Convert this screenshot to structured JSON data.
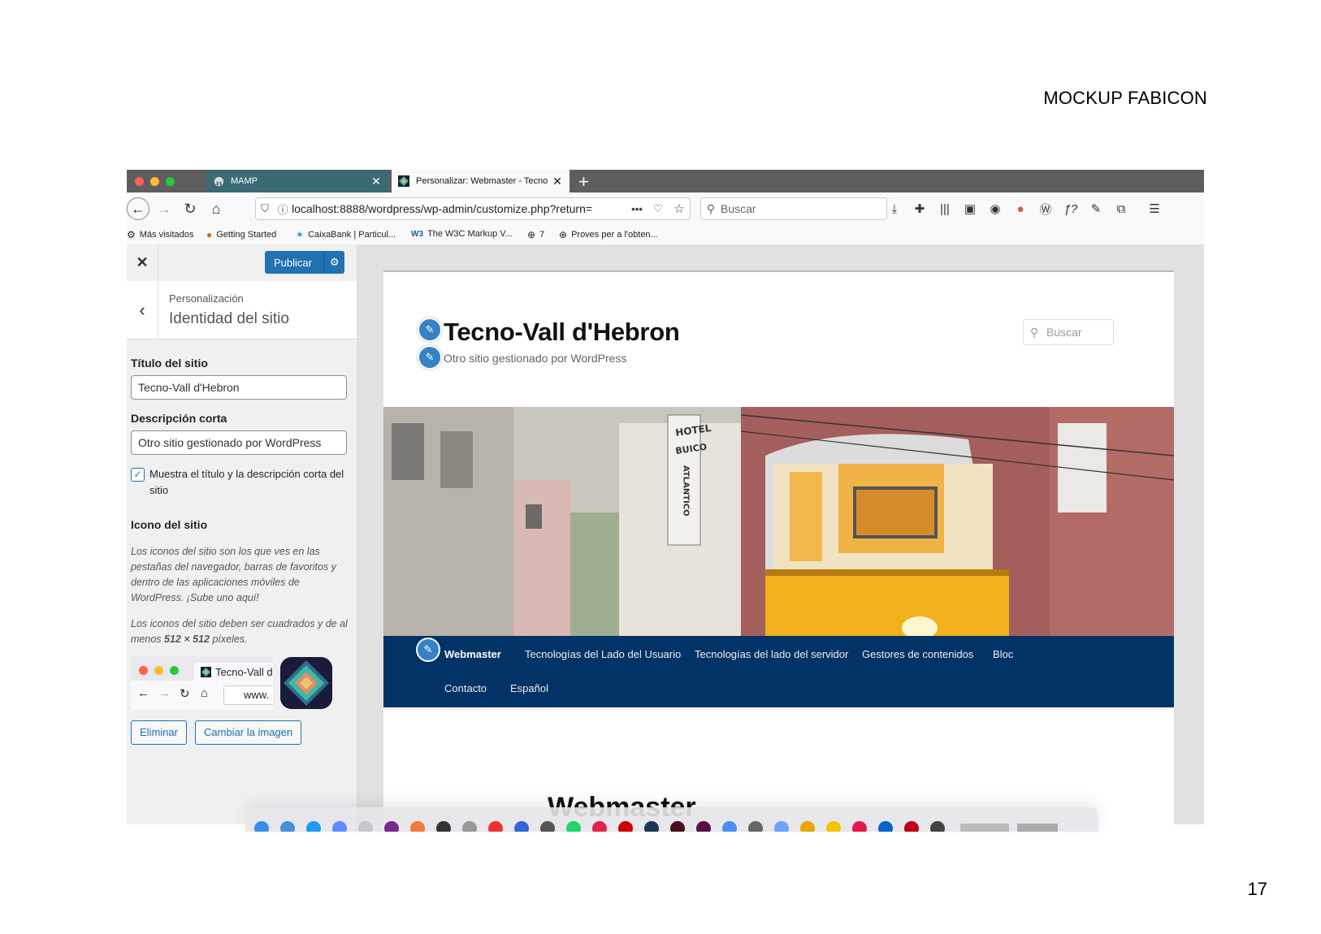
{
  "slide": {
    "title": "MOCKUP FABICON",
    "page_number": "17"
  },
  "browser": {
    "tabs": [
      {
        "label": "MAMP",
        "icon": "elephant-icon",
        "active": false
      },
      {
        "label": "Personalizar: Webmaster - Tecno",
        "icon": "site-favicon-icon",
        "active": true
      }
    ],
    "url": "localhost:8888/wordpress/wp-admin/customize.php?return=",
    "search_placeholder": "Buscar",
    "bookmarks": [
      {
        "label": "Más visitados",
        "icon": "gear-icon"
      },
      {
        "label": "Getting Started",
        "icon": "firefox-icon"
      },
      {
        "label": "CaixaBank | Particul...",
        "icon": "caixabank-icon"
      },
      {
        "label": "The W3C Markup V...",
        "icon": "w3c-icon"
      },
      {
        "label": "7",
        "icon": "globe-icon"
      },
      {
        "label": "Proves per a l'obten...",
        "icon": "globe-icon"
      }
    ]
  },
  "customizer": {
    "publish_label": "Publicar",
    "breadcrumb": "Personalización",
    "section_title": "Identidad del sitio",
    "site_title_label": "Título del sitio",
    "site_title_value": "Tecno-Vall d'Hebron",
    "tagline_label": "Descripción corta",
    "tagline_value": "Otro sitio gestionado por WordPress",
    "display_header_text_label": "Muestra el título y la descripción corta del sitio",
    "display_header_text_checked": true,
    "site_icon_label": "Icono del sitio",
    "site_icon_desc_1": "Los iconos del sitio son los que ves en las pestañas del navegador, barras de favoritos y dentro de las aplicaciones móviles de WordPress. ¡Sube uno aquí!",
    "site_icon_desc_2_before": "Los iconos del sitio deben ser cuadrados y de al menos ",
    "site_icon_desc_2_size": "512 × 512",
    "site_icon_desc_2_after": " píxeles.",
    "mini_tab_label": "Tecno-Vall d",
    "mini_url": "www.",
    "remove_label": "Eliminar",
    "change_label": "Cambiar la imagen"
  },
  "site_preview": {
    "title": "Tecno-Vall d'Hebron",
    "tagline": "Otro sitio gestionado por WordPress",
    "search_placeholder": "Buscar",
    "hotel_sign_1": "HOTEL",
    "hotel_sign_2": "BUICO",
    "hotel_sign_3": "ATLANTICO",
    "menu": [
      "Webmaster",
      "Tecnologías del Lado del Usuario",
      "Tecnologías del lado del servidor",
      "Gestores de contenidos",
      "Bloc",
      "Contacto",
      "Español"
    ],
    "page_heading": "Webmaster"
  },
  "colors": {
    "wp_blue": "#2271b1",
    "nav_bg": "#013366",
    "tab_inactive": "#3a6a73"
  }
}
